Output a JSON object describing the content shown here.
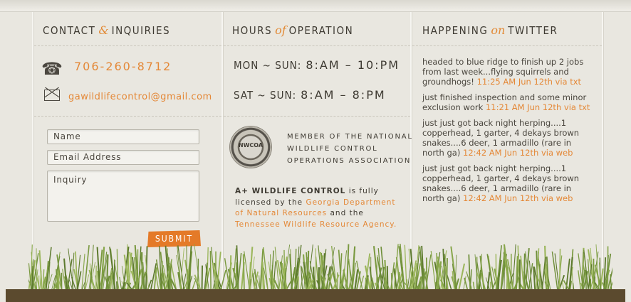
{
  "contact": {
    "title_left": "CONTACT",
    "title_amp": "&",
    "title_right": "INQUIRIES",
    "phone": "706-260-8712",
    "email": "gawildlifecontrol@gmail.com",
    "form": {
      "name_placeholder": "Name",
      "email_placeholder": "Email Address",
      "inquiry_placeholder": "Inquiry",
      "submit_label": "SUBMIT"
    }
  },
  "hours": {
    "title_left": "HOURS",
    "title_amp": "of",
    "title_right": "OPERATION",
    "rows": [
      {
        "days": "MON ~ SUN:",
        "time": "8:AM – 10:PM"
      },
      {
        "days": "SAT ~ SUN:",
        "time": "8:AM – 8:PM"
      }
    ],
    "seal_text": "NWCOA",
    "assoc_lines": [
      "MEMBER OF THE NATIONAL",
      "WILDLIFE CONTROL",
      "OPERATIONS ASSOCIATION"
    ],
    "license_company": "A+ WILDLIFE CONTROL",
    "license_text1": " is fully licensed by the ",
    "license_org1": "Georgia Department of Natural Resources",
    "license_text2": " and the ",
    "license_org2": "Tennessee Wildlife Resource Agency",
    "license_end": "."
  },
  "twitter": {
    "title_left": "HAPPENING",
    "title_amp": "on",
    "title_right": "TWITTER",
    "tweets": [
      {
        "text": "headed to blue ridge to finish up 2 jobs from last week...flying squirrels and groundhogs! ",
        "meta": "11:25 AM Jun 12th via txt"
      },
      {
        "text": "just finished inspection and some minor exclusion work ",
        "meta": "11:21 AM Jun 12th via txt"
      },
      {
        "text": "just just got back night herping....1 copperhead, 1 garter, 4 dekays brown snakes....6 deer, 1 armadillo (rare in north ga) ",
        "meta": "12:42 AM Jun 12th via web"
      },
      {
        "text": "just just got back night herping....1 copperhead, 1 garter, 4 dekays brown snakes....6 deer, 1 armadillo (rare in north ga) ",
        "meta": "12:42 AM Jun 12th via web"
      }
    ]
  },
  "icons": {
    "phone": "phone-icon",
    "email": "envelope-icon",
    "seal": "nwcoa-seal-logo"
  },
  "colors": {
    "accent": "#e48837",
    "text": "#3e3a32",
    "background": "#e9e7e0",
    "ground": "#5b4a2e"
  }
}
